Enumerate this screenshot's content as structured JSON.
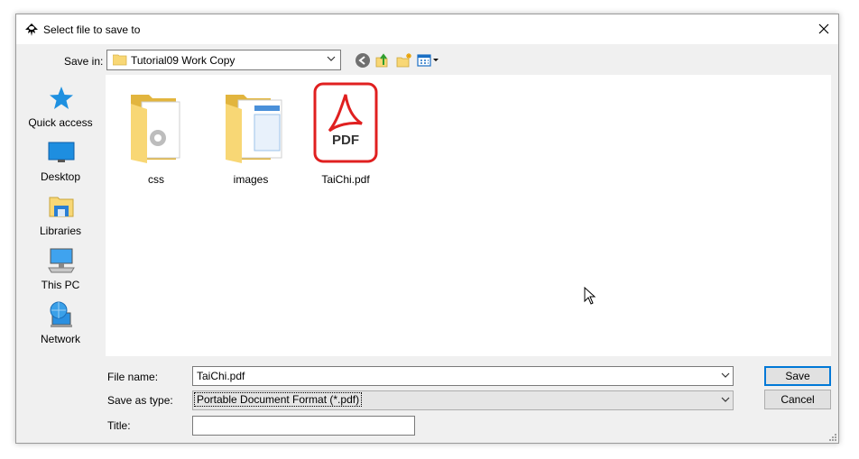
{
  "window": {
    "title": "Select file to save to"
  },
  "toolbar": {
    "save_in_label": "Save in:",
    "save_in_value": "Tutorial09 Work Copy"
  },
  "places": [
    {
      "label": "Quick access",
      "icon": "star-icon"
    },
    {
      "label": "Desktop",
      "icon": "desktop-icon"
    },
    {
      "label": "Libraries",
      "icon": "libraries-icon"
    },
    {
      "label": "This PC",
      "icon": "computer-icon"
    },
    {
      "label": "Network",
      "icon": "network-icon"
    }
  ],
  "files": [
    {
      "name": "css",
      "kind": "folder"
    },
    {
      "name": "images",
      "kind": "folder"
    },
    {
      "name": "TaiChi.pdf",
      "kind": "pdf",
      "badge": "PDF"
    }
  ],
  "form": {
    "file_name_label": "File name:",
    "file_name_value": "TaiChi.pdf",
    "save_as_type_label": "Save as type:",
    "save_as_type_value": "Portable Document Format (*.pdf)",
    "title_label": "Title:",
    "title_value": ""
  },
  "buttons": {
    "save": "Save",
    "cancel": "Cancel"
  },
  "colors": {
    "pdf_red": "#e02020",
    "folder_yellow": "#f8d775",
    "accent": "#0078d7"
  }
}
